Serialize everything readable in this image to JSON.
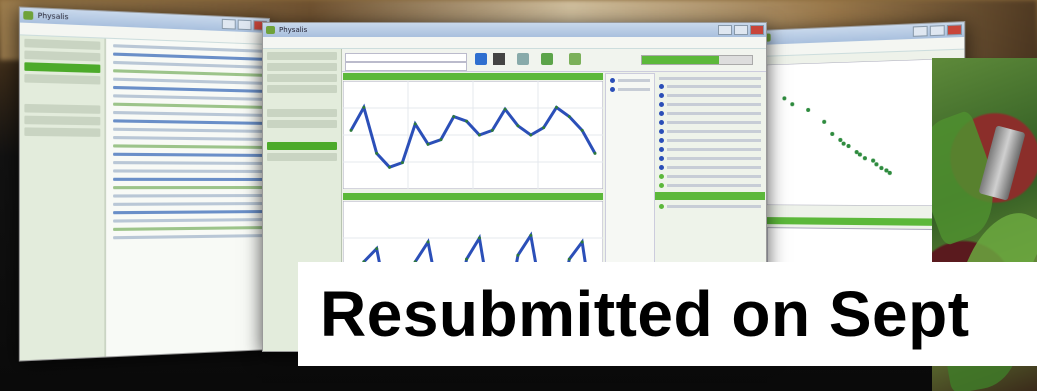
{
  "banner": {
    "text": "Resubmitted on Sept"
  },
  "left_window": {
    "title_prefix": "Physalis"
  },
  "middle_window": {
    "title_prefix": "Physalis"
  },
  "colors": {
    "accent_green": "#5cb83a",
    "series_blue": "#2b4fb8",
    "series_green": "#3e9a4a",
    "scatter_green": "#2e8b3e"
  },
  "chart_data": [
    {
      "type": "line",
      "title": "",
      "xlabel": "",
      "ylabel": "",
      "series": [
        {
          "values": [
            0.55,
            0.8,
            0.3,
            0.15,
            0.2,
            0.62,
            0.4,
            0.45,
            0.7,
            0.65,
            0.5,
            0.55,
            0.78,
            0.6,
            0.5,
            0.58,
            0.8,
            0.7,
            0.55,
            0.3
          ]
        }
      ]
    },
    {
      "type": "line",
      "title": "",
      "xlabel": "",
      "ylabel": "",
      "series": [
        {
          "values": [
            0.1,
            0.6,
            0.7,
            0.2,
            0.1,
            0.6,
            0.75,
            0.25,
            0.1,
            0.62,
            0.78,
            0.2,
            0.1,
            0.65,
            0.8,
            0.25,
            0.1,
            0.62,
            0.75,
            0.1
          ]
        }
      ]
    },
    {
      "type": "scatter",
      "title": "",
      "xlabel": "",
      "ylabel": "",
      "x": [
        0.05,
        0.1,
        0.2,
        0.3,
        0.35,
        0.4,
        0.42,
        0.45,
        0.5,
        0.52,
        0.55,
        0.6,
        0.62,
        0.65,
        0.68,
        0.7
      ],
      "y": [
        0.8,
        0.75,
        0.7,
        0.6,
        0.5,
        0.45,
        0.42,
        0.4,
        0.35,
        0.33,
        0.3,
        0.28,
        0.25,
        0.22,
        0.2,
        0.18
      ]
    }
  ]
}
